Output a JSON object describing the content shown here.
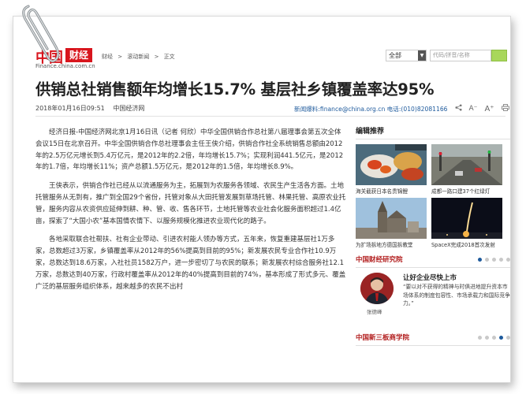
{
  "header": {
    "logo_red": "中国",
    "logo_box": "财经",
    "logo_sub": "Finance.china.com.cn",
    "breadcrumb": [
      "财经",
      ">",
      "滚动新闻",
      ">",
      "正文"
    ],
    "search_select": "全部",
    "search_placeholder": "代码/拼音/名称"
  },
  "article": {
    "title": "供销总社销售额年均增长15.7% 基层社乡镇覆盖率达95%",
    "datetime": "2018年01月16日09:51",
    "source": "中国经济网",
    "hotline": "新闻爆料:finance@china.org.cn 电话:(010)82081166",
    "font_minus": "A⁻",
    "font_plus": "A⁺",
    "paragraphs": [
      "经济日报-中国经济网北京1月16日讯（记者 何欣）中华全国供销合作总社第八届理事会第五次全体会议15日在北京召开。中华全国供销合作总社理事会主任王侠介绍，供销合作社全系统销售总额由2012年的2.5万亿元增长到5.4万亿元，是2012年的2.2倍，年均增长15.7%；实现利润441.5亿元，是2012年的1.7倍，年均增长11%；资产总额1.5万亿元，是2012年的1.5倍，年均增长8.9%。",
      "王侠表示，供销合作社已经从以流通服务为主，拓展到为农服务各领域、农民生产生活各方面。土地托管服务从无到有，推广到全国29个省份，托管对象从大田托管发展到草场托管、林果托管、高原农业托管，服务内容从农资供应延伸到耕、种、管、收、售各环节，土地托管等农业社会化服务面积超过1.4亿亩，探索了“大国小农”基本国情农情下、以服务规模化推进农业现代化的路子。",
      "各地采取联合社帮扶、社有企业带动、引进农村能人领办等方式，五年来，恢复重建基层社1万多家，总数超过3万家，乡镇覆盖率从2012年的56%提高到目前的95%；新发展农民专业合作社10.9万家，总数达到18.6万家，入社社员1582万户，进一步密切了与农民的联系；新发展农村综合服务社12.1万家，总数达到40万家，行政村覆盖率从2012年的40%提高到目前的74%，基本形成了形式多元、覆盖广泛的基层服务组织体系，越来越多的农民不出村"
    ]
  },
  "sidebar": {
    "heading": "编辑推荐",
    "thumbs": [
      {
        "caption": "海关截获日本名贵锦鲤"
      },
      {
        "caption": "成都一路口建37个红绿灯"
      },
      {
        "caption": "为扩场拆地方德国拆教堂"
      },
      {
        "caption": "SpaceX完成2018首次发射"
      }
    ],
    "section1_title": "中国财经研究院",
    "feature": {
      "title": "让好企业尽快上市",
      "text": "“要以对不获得的精神与时俱进地提升资本市场体系的制度包容性、市场承载力和国际竞争力。”",
      "person": "张德峰"
    },
    "section2_title": "中国新三板商学院"
  },
  "colors": {
    "brand_red": "#d8151d",
    "link_blue": "#1e5a9c",
    "section_red": "#b21d1d",
    "search_green": "#a8d75b"
  }
}
